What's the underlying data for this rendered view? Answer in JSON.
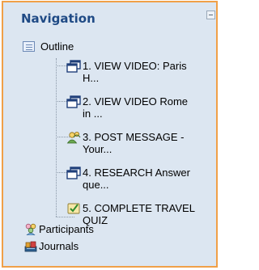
{
  "block": {
    "title": "Navigation",
    "outline_label": "Outline",
    "activities": [
      {
        "icon": "page-window-icon",
        "line1": "1. VIEW VIDEO: Paris",
        "line2": "H..."
      },
      {
        "icon": "page-window-icon",
        "line1": "2. VIEW VIDEO Rome",
        "line2": "in ..."
      },
      {
        "icon": "forum-icon",
        "line1": "3. POST MESSAGE -",
        "line2": "Your..."
      },
      {
        "icon": "page-window-icon",
        "line1": "4. RESEARCH Answer",
        "line2": "que..."
      },
      {
        "icon": "quiz-icon",
        "line1": "5. COMPLETE TRAVEL",
        "line2": "QUIZ"
      }
    ],
    "participants_label": "Participants",
    "journals_label": "Journals"
  },
  "colors": {
    "block_background": "#dce6f1",
    "block_border": "#f0a048",
    "title": "#1f4a85"
  }
}
